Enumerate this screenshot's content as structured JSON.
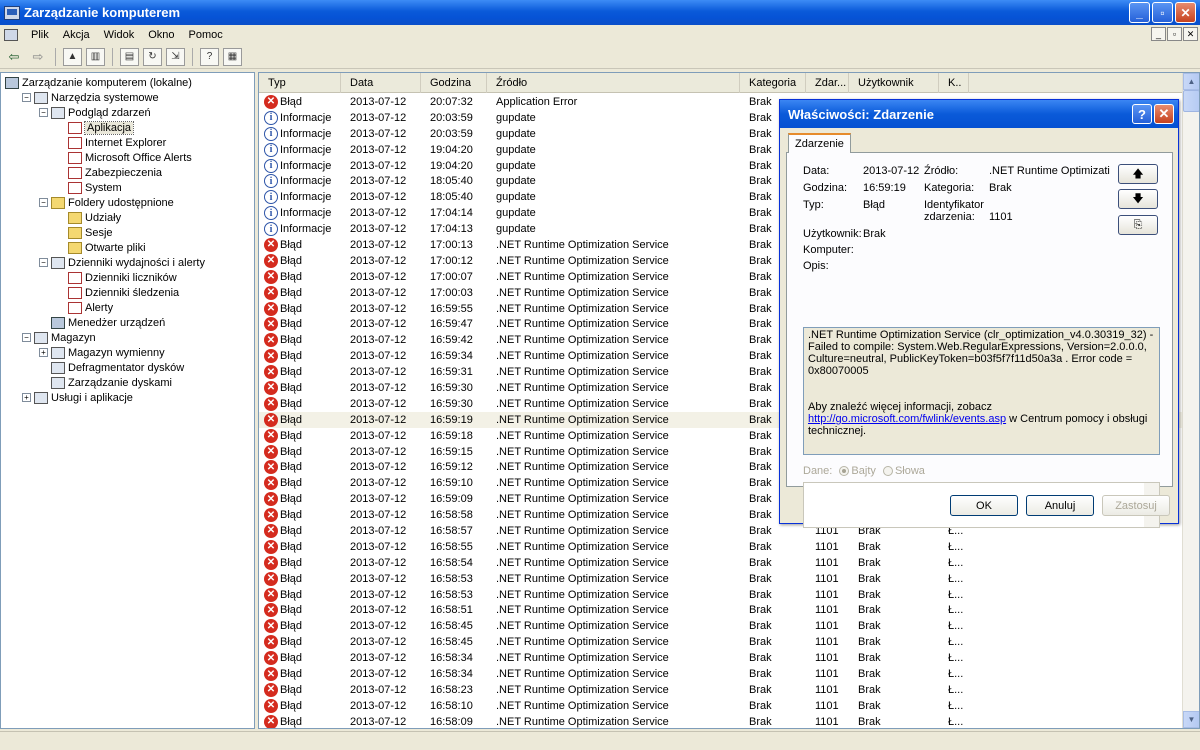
{
  "window": {
    "title": "Zarządzanie komputerem",
    "buttons": [
      "_",
      "▫",
      "✕"
    ]
  },
  "menu": [
    "Plik",
    "Akcja",
    "Widok",
    "Okno",
    "Pomoc"
  ],
  "mdi_buttons": [
    "_",
    "▫",
    "✕"
  ],
  "tree": [
    {
      "label": "Zarządzanie komputerem (lokalne)",
      "level": 0,
      "expander": "",
      "icon": "computer-icon"
    },
    {
      "label": "Narzędzia systemowe",
      "level": 1,
      "expander": "−",
      "icon": "tools-icon"
    },
    {
      "label": "Podgląd zdarzeń",
      "level": 2,
      "expander": "−",
      "icon": "event-viewer-icon"
    },
    {
      "label": "Aplikacja",
      "level": 3,
      "expander": "",
      "icon": "log-icon",
      "selected": true
    },
    {
      "label": "Internet Explorer",
      "level": 3,
      "expander": "",
      "icon": "log-icon"
    },
    {
      "label": "Microsoft Office Alerts",
      "level": 3,
      "expander": "",
      "icon": "log-icon"
    },
    {
      "label": "Zabezpieczenia",
      "level": 3,
      "expander": "",
      "icon": "log-icon"
    },
    {
      "label": "System",
      "level": 3,
      "expander": "",
      "icon": "log-icon"
    },
    {
      "label": "Foldery udostępnione",
      "level": 2,
      "expander": "−",
      "icon": "folder-icon"
    },
    {
      "label": "Udziały",
      "level": 3,
      "expander": "",
      "icon": "folder-icon"
    },
    {
      "label": "Sesje",
      "level": 3,
      "expander": "",
      "icon": "folder-icon"
    },
    {
      "label": "Otwarte pliki",
      "level": 3,
      "expander": "",
      "icon": "folder-icon"
    },
    {
      "label": "Dzienniki wydajności i alerty",
      "level": 2,
      "expander": "−",
      "icon": "performance-icon"
    },
    {
      "label": "Dzienniki liczników",
      "level": 3,
      "expander": "",
      "icon": "log-icon"
    },
    {
      "label": "Dzienniki śledzenia",
      "level": 3,
      "expander": "",
      "icon": "log-icon"
    },
    {
      "label": "Alerty",
      "level": 3,
      "expander": "",
      "icon": "log-icon"
    },
    {
      "label": "Menedżer urządzeń",
      "level": 2,
      "expander": "",
      "icon": "device-manager-icon"
    },
    {
      "label": "Magazyn",
      "level": 1,
      "expander": "−",
      "icon": "storage-icon"
    },
    {
      "label": "Magazyn wymienny",
      "level": 2,
      "expander": "+",
      "icon": "removable-storage-icon"
    },
    {
      "label": "Defragmentator dysków",
      "level": 2,
      "expander": "",
      "icon": "defrag-icon"
    },
    {
      "label": "Zarządzanie dyskami",
      "level": 2,
      "expander": "",
      "icon": "disk-management-icon"
    },
    {
      "label": "Usługi i aplikacje",
      "level": 1,
      "expander": "+",
      "icon": "services-icon"
    }
  ],
  "columns": [
    {
      "label": "Typ",
      "w": 82
    },
    {
      "label": "Data",
      "w": 80
    },
    {
      "label": "Godzina",
      "w": 66
    },
    {
      "label": "Źródło",
      "w": 253
    },
    {
      "label": "Kategoria",
      "w": 66
    },
    {
      "label": "Zdar...",
      "w": 43
    },
    {
      "label": "Użytkownik",
      "w": 90
    },
    {
      "label": "K..",
      "w": 30
    }
  ],
  "events": [
    [
      "Błąd",
      "2013-07-12",
      "20:07:32",
      "Application Error",
      "Brak",
      "",
      "",
      " "
    ],
    [
      "Informacje",
      "2013-07-12",
      "20:03:59",
      "gupdate",
      "Brak",
      "",
      "",
      ""
    ],
    [
      "Informacje",
      "2013-07-12",
      "20:03:59",
      "gupdate",
      "Brak",
      "",
      "",
      ""
    ],
    [
      "Informacje",
      "2013-07-12",
      "19:04:20",
      "gupdate",
      "Brak",
      "",
      "",
      ""
    ],
    [
      "Informacje",
      "2013-07-12",
      "19:04:20",
      "gupdate",
      "Brak",
      "",
      "",
      ""
    ],
    [
      "Informacje",
      "2013-07-12",
      "18:05:40",
      "gupdate",
      "Brak",
      "",
      "",
      ""
    ],
    [
      "Informacje",
      "2013-07-12",
      "18:05:40",
      "gupdate",
      "Brak",
      "",
      "",
      ""
    ],
    [
      "Informacje",
      "2013-07-12",
      "17:04:14",
      "gupdate",
      "Brak",
      "",
      "",
      ""
    ],
    [
      "Informacje",
      "2013-07-12",
      "17:04:13",
      "gupdate",
      "Brak",
      "",
      "",
      ""
    ],
    [
      "Błąd",
      "2013-07-12",
      "17:00:13",
      ".NET Runtime Optimization Service",
      "Brak",
      "",
      "",
      ""
    ],
    [
      "Błąd",
      "2013-07-12",
      "17:00:12",
      ".NET Runtime Optimization Service",
      "Brak",
      "",
      "",
      ""
    ],
    [
      "Błąd",
      "2013-07-12",
      "17:00:07",
      ".NET Runtime Optimization Service",
      "Brak",
      "",
      "",
      ""
    ],
    [
      "Błąd",
      "2013-07-12",
      "17:00:03",
      ".NET Runtime Optimization Service",
      "Brak",
      "",
      "",
      ""
    ],
    [
      "Błąd",
      "2013-07-12",
      "16:59:55",
      ".NET Runtime Optimization Service",
      "Brak",
      "",
      "",
      ""
    ],
    [
      "Błąd",
      "2013-07-12",
      "16:59:47",
      ".NET Runtime Optimization Service",
      "Brak",
      "",
      "",
      ""
    ],
    [
      "Błąd",
      "2013-07-12",
      "16:59:42",
      ".NET Runtime Optimization Service",
      "Brak",
      "",
      "",
      ""
    ],
    [
      "Błąd",
      "2013-07-12",
      "16:59:34",
      ".NET Runtime Optimization Service",
      "Brak",
      "",
      "",
      ""
    ],
    [
      "Błąd",
      "2013-07-12",
      "16:59:31",
      ".NET Runtime Optimization Service",
      "Brak",
      "",
      "",
      ""
    ],
    [
      "Błąd",
      "2013-07-12",
      "16:59:30",
      ".NET Runtime Optimization Service",
      "Brak",
      "",
      "",
      ""
    ],
    [
      "Błąd",
      "2013-07-12",
      "16:59:30",
      ".NET Runtime Optimization Service",
      "Brak",
      "",
      "",
      ""
    ],
    [
      "Błąd",
      "2013-07-12",
      "16:59:19",
      ".NET Runtime Optimization Service",
      "Brak",
      "",
      "",
      ""
    ],
    [
      "Błąd",
      "2013-07-12",
      "16:59:18",
      ".NET Runtime Optimization Service",
      "Brak",
      "",
      "",
      ""
    ],
    [
      "Błąd",
      "2013-07-12",
      "16:59:15",
      ".NET Runtime Optimization Service",
      "Brak",
      "",
      "",
      ""
    ],
    [
      "Błąd",
      "2013-07-12",
      "16:59:12",
      ".NET Runtime Optimization Service",
      "Brak",
      "",
      "",
      ""
    ],
    [
      "Błąd",
      "2013-07-12",
      "16:59:10",
      ".NET Runtime Optimization Service",
      "Brak",
      "",
      "",
      ""
    ],
    [
      "Błąd",
      "2013-07-12",
      "16:59:09",
      ".NET Runtime Optimization Service",
      "Brak",
      "",
      "",
      ""
    ],
    [
      "Błąd",
      "2013-07-12",
      "16:58:58",
      ".NET Runtime Optimization Service",
      "Brak",
      "",
      "",
      ""
    ],
    [
      "Błąd",
      "2013-07-12",
      "16:58:57",
      ".NET Runtime Optimization Service",
      "Brak",
      "1101",
      "Brak",
      "Ł..."
    ],
    [
      "Błąd",
      "2013-07-12",
      "16:58:55",
      ".NET Runtime Optimization Service",
      "Brak",
      "1101",
      "Brak",
      "Ł..."
    ],
    [
      "Błąd",
      "2013-07-12",
      "16:58:54",
      ".NET Runtime Optimization Service",
      "Brak",
      "1101",
      "Brak",
      "Ł..."
    ],
    [
      "Błąd",
      "2013-07-12",
      "16:58:53",
      ".NET Runtime Optimization Service",
      "Brak",
      "1101",
      "Brak",
      "Ł..."
    ],
    [
      "Błąd",
      "2013-07-12",
      "16:58:53",
      ".NET Runtime Optimization Service",
      "Brak",
      "1101",
      "Brak",
      "Ł..."
    ],
    [
      "Błąd",
      "2013-07-12",
      "16:58:51",
      ".NET Runtime Optimization Service",
      "Brak",
      "1101",
      "Brak",
      "Ł..."
    ],
    [
      "Błąd",
      "2013-07-12",
      "16:58:45",
      ".NET Runtime Optimization Service",
      "Brak",
      "1101",
      "Brak",
      "Ł..."
    ],
    [
      "Błąd",
      "2013-07-12",
      "16:58:45",
      ".NET Runtime Optimization Service",
      "Brak",
      "1101",
      "Brak",
      "Ł..."
    ],
    [
      "Błąd",
      "2013-07-12",
      "16:58:34",
      ".NET Runtime Optimization Service",
      "Brak",
      "1101",
      "Brak",
      "Ł..."
    ],
    [
      "Błąd",
      "2013-07-12",
      "16:58:34",
      ".NET Runtime Optimization Service",
      "Brak",
      "1101",
      "Brak",
      "Ł..."
    ],
    [
      "Błąd",
      "2013-07-12",
      "16:58:23",
      ".NET Runtime Optimization Service",
      "Brak",
      "1101",
      "Brak",
      "Ł..."
    ],
    [
      "Błąd",
      "2013-07-12",
      "16:58:10",
      ".NET Runtime Optimization Service",
      "Brak",
      "1101",
      "Brak",
      "Ł..."
    ],
    [
      "Błąd",
      "2013-07-12",
      "16:58:09",
      ".NET Runtime Optimization Service",
      "Brak",
      "1101",
      "Brak",
      "Ł..."
    ]
  ],
  "highlighted_row": 20,
  "dialog": {
    "title": "Właściwości: Zdarzenie",
    "title_buttons": [
      "?",
      "✕"
    ],
    "tab": "Zdarzenie",
    "data_label": "Data:",
    "data_value": "2013-07-12",
    "source_label": "Źródło:",
    "source_value": ".NET Runtime Optimizati",
    "time_label": "Godzina:",
    "time_value": "16:59:19",
    "category_label": "Kategoria:",
    "category_value": "Brak",
    "type_label": "Typ:",
    "type_value": "Błąd",
    "id_label_1": "Identyfikator",
    "id_label_2": "zdarzenia:",
    "id_value": "1101",
    "user_label": "Użytkownik:",
    "user_value": "Brak",
    "computer_label": "Komputer:",
    "desc_label": "Opis:",
    "description_1": ".NET Runtime Optimization Service (clr_optimization_v4.0.30319_32) - Failed to compile: System.Web.RegularExpressions, Version=2.0.0.0, Culture=neutral, PublicKeyToken=b03f5f7f11d50a3a . Error code = 0x80070005",
    "description_2": "Aby znaleźć więcej informacji, zobacz",
    "link": "http://go.microsoft.com/fwlink/events.asp",
    "description_3": " w Centrum pomocy i obsługi technicznej.",
    "data_section_label": "Dane:",
    "radio_bytes": "Bajty",
    "radio_words": "Słowa",
    "nav_up": "🡅",
    "nav_down": "🡇",
    "nav_copy": "⎘",
    "ok": "OK",
    "cancel": "Anuluj",
    "apply": "Zastosuj"
  },
  "icons": {
    "error": "error-icon",
    "info": "info-icon"
  }
}
